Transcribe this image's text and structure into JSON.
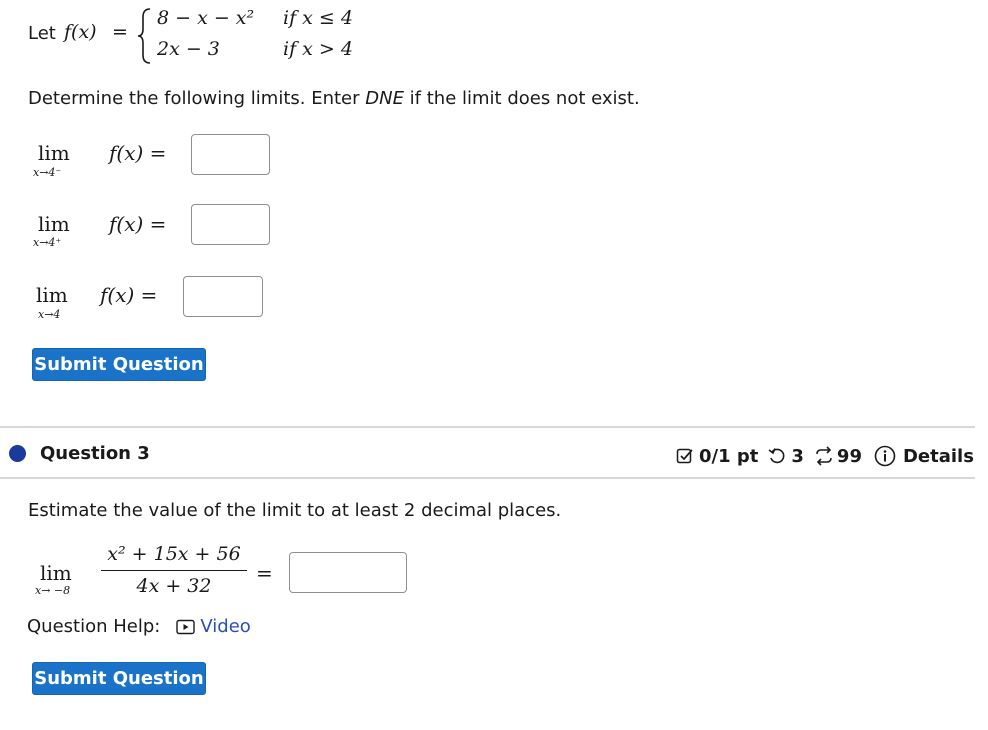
{
  "q2": {
    "let_label": "Let",
    "func_lhs": "f(x)",
    "equals": "=",
    "case1_expr": "8 − x − x²",
    "case1_cond": "if  x ≤ 4",
    "case2_expr": "2x − 3",
    "case2_cond": "if  x > 4",
    "instructions_pre": "Determine the following limits. Enter ",
    "instructions_dne": "DNE",
    "instructions_post": " if the limit does not exist.",
    "limits": [
      {
        "lim": "lim",
        "sub": "x→4⁻",
        "expr": "f(x) =",
        "answer": ""
      },
      {
        "lim": "lim",
        "sub": "x→4⁺",
        "expr": "f(x) =",
        "answer": ""
      },
      {
        "lim": "lim",
        "sub": "x→4",
        "expr": "f(x) =",
        "answer": ""
      }
    ],
    "submit_label": "Submit Question"
  },
  "q3": {
    "title": "Question 3",
    "score": "0/1 pt",
    "retries": "3",
    "attempts": "99",
    "details_label": "Details",
    "instructions": "Estimate the value of the limit to at least 2 decimal places.",
    "lim": "lim",
    "lim_sub": "x→ −8",
    "numerator": "x² + 15x + 56",
    "denominator": "4x + 32",
    "equals": "=",
    "answer": "",
    "help_label": "Question Help:",
    "video_label": "Video",
    "submit_label": "Submit Question"
  },
  "colors": {
    "accent": "#1a73c8",
    "bullet": "#1a3a9e",
    "link": "#2a4fb5"
  }
}
